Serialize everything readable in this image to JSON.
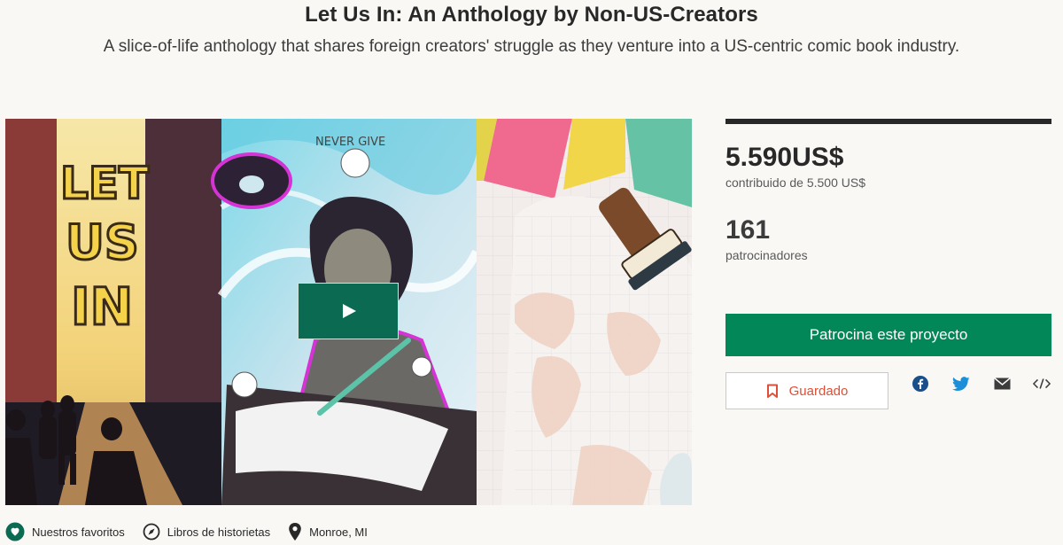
{
  "project": {
    "title": "Let Us In: An Anthology by Non-US-Creators",
    "blurb": "A slice-of-life anthology that shares foreign creators' struggle as they venture into a US-centric comic book industry.",
    "cover_text": [
      "LET",
      "US",
      "IN"
    ]
  },
  "stats": {
    "pledged": "5.590US$",
    "goal_text": "contribuido de 5.500 US$",
    "funded_fraction": 1.0,
    "backers": "161",
    "backers_label": "patrocinadores"
  },
  "actions": {
    "back_label": "Patrocina este proyecto",
    "saved_label": "Guardado"
  },
  "share": [
    "facebook-icon",
    "twitter-icon",
    "email-icon",
    "embed-icon"
  ],
  "footer": {
    "favorites": "Nuestros favoritos",
    "category": "Libros de historietas",
    "location": "Monroe, MI"
  },
  "colors": {
    "accent": "#028858",
    "play": "#0b6b52",
    "saved": "#dd4f36",
    "text": "#282828",
    "background": "#f9f8f5"
  }
}
